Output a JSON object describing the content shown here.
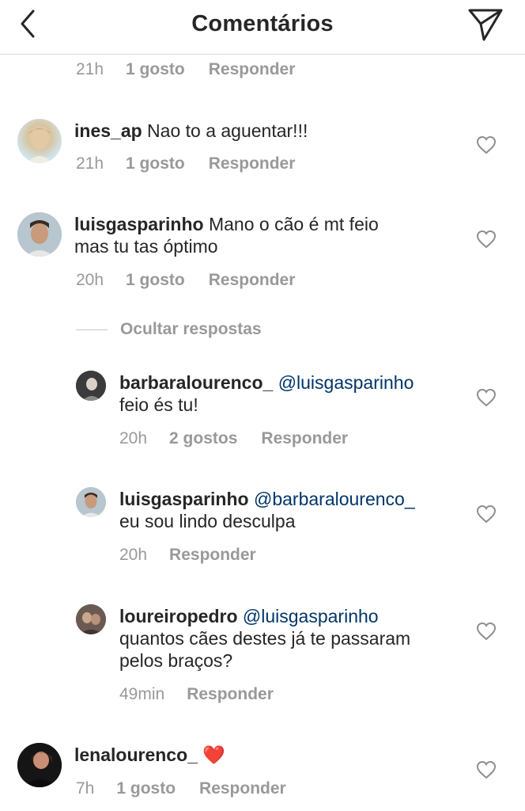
{
  "header": {
    "title": "Comentários",
    "back_icon": "chevron-left-icon",
    "send_icon": "paper-plane-icon"
  },
  "top_meta": {
    "time": "21h",
    "likes": "1 gosto",
    "reply": "Responder"
  },
  "comments": [
    {
      "username": "ines_ap",
      "text": "Nao to a aguentar!!!",
      "time": "21h",
      "likes": "1 gosto",
      "reply": "Responder"
    },
    {
      "username": "luisgasparinho",
      "text_line1": "Mano o cão é mt feio",
      "text_line2": "mas tu tas óptimo",
      "time": "20h",
      "likes": "1 gosto",
      "reply": "Responder"
    }
  ],
  "hide_replies_label": "Ocultar respostas",
  "replies": [
    {
      "username": "barbaralourenco_",
      "mention": "@luisgasparinho",
      "text": "feio és tu!",
      "time": "20h",
      "likes": "2 gostos",
      "reply": "Responder"
    },
    {
      "username": "luisgasparinho",
      "mention": "@barbaralourenco_",
      "text": "eu sou lindo desculpa",
      "time": "20h",
      "reply": "Responder"
    },
    {
      "username": "loureiropedro",
      "mention": "@luisgasparinho",
      "text_line1": "quantos cães destes já te passaram",
      "text_line2": "pelos braços?",
      "time": "49min",
      "reply": "Responder"
    }
  ],
  "last_comment": {
    "username": "lenalourenco_",
    "emoji": "❤️",
    "time": "7h",
    "likes": "1 gosto",
    "reply": "Responder"
  },
  "colors": {
    "text": "#262626",
    "meta": "#999999",
    "mention": "#003569",
    "divider": "#dbdbdb"
  }
}
